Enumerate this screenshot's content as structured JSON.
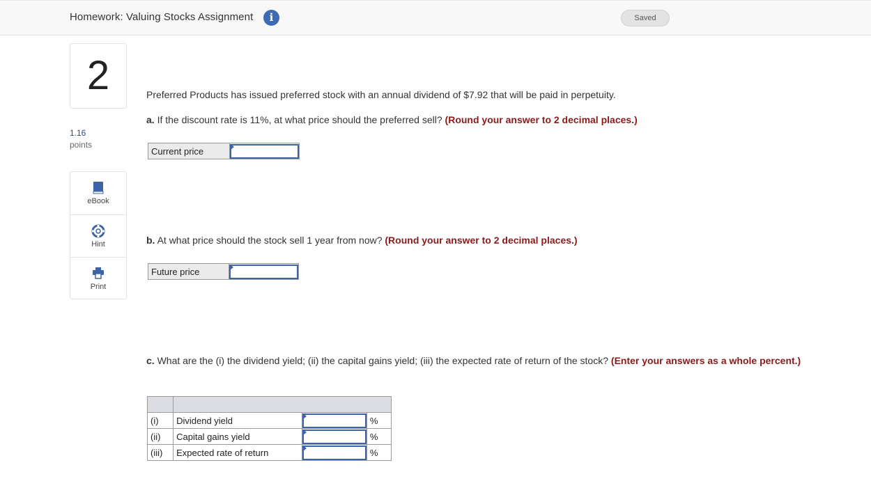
{
  "header": {
    "title": "Homework: Valuing Stocks Assignment",
    "info_glyph": "i",
    "saved_label": "Saved"
  },
  "question": {
    "number": "2",
    "points_value": "1.16",
    "points_label": "points"
  },
  "tools": [
    {
      "label": "eBook",
      "icon": "book-icon"
    },
    {
      "label": "Hint",
      "icon": "lifebuoy-icon"
    },
    {
      "label": "Print",
      "icon": "printer-icon"
    }
  ],
  "problem": {
    "intro": "Preferred Products has issued preferred stock with an annual dividend of $7.92 that will be paid in perpetuity.",
    "a_prefix": "a.",
    "a_text": " If the discount rate is 11%, at what price should the preferred sell? ",
    "a_emphasis": "(Round your answer to 2 decimal places.)",
    "a_field_label": "Current price",
    "a_field_value": "",
    "b_prefix": "b.",
    "b_text": " At what price should the stock sell 1 year from now? ",
    "b_emphasis": "(Round your answer to 2 decimal places.)",
    "b_field_label": "Future price",
    "b_field_value": "",
    "c_prefix": "c.",
    "c_text": " What are the (i) the dividend yield; (ii) the capital gains yield; (iii) the expected rate of return of the stock? ",
    "c_emphasis": "(Enter your answers as a whole percent.)",
    "c_rows": [
      {
        "roman": "(i)",
        "label": "Dividend yield",
        "value": "",
        "unit": "%"
      },
      {
        "roman": "(ii)",
        "label": "Capital gains yield",
        "value": "",
        "unit": "%"
      },
      {
        "roman": "(iii)",
        "label": "Expected rate of return",
        "value": "",
        "unit": "%"
      }
    ]
  },
  "colors": {
    "accent_blue": "#3d63a8",
    "emphasis_red": "#8b1a1a",
    "info_blue": "#3d6bb3"
  }
}
